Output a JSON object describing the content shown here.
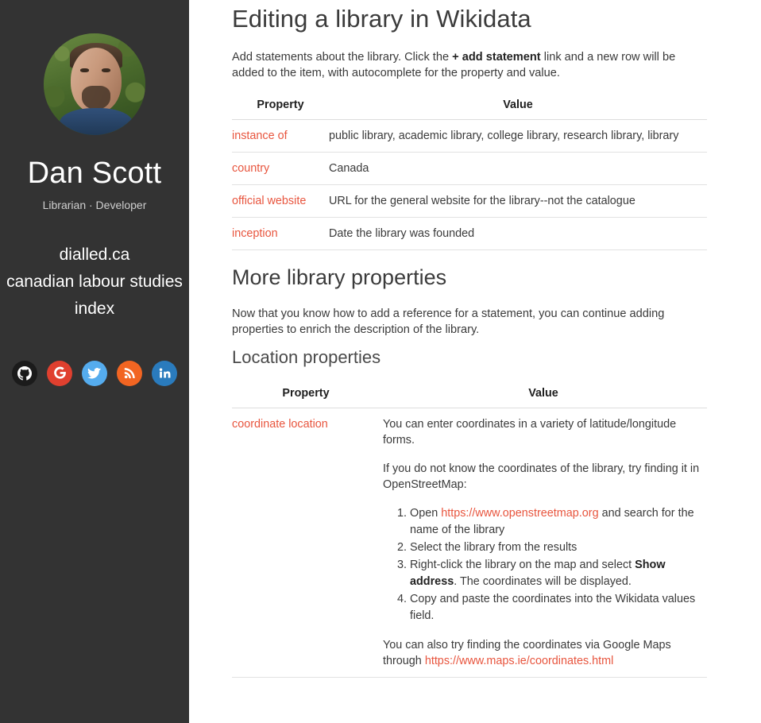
{
  "sidebar": {
    "avatar_alt": "portrait photo of Dan Scott",
    "name": "Dan Scott",
    "tagline": "Librarian · Developer",
    "nav": [
      {
        "label": "dialled.ca"
      },
      {
        "label": "canadian labour studies index"
      }
    ],
    "social": [
      {
        "name": "github-icon",
        "label": "GitHub",
        "color": "#1b1b1b"
      },
      {
        "name": "google-icon",
        "label": "Google",
        "color": "#e0402f"
      },
      {
        "name": "twitter-icon",
        "label": "Twitter",
        "color": "#55acee"
      },
      {
        "name": "rss-icon",
        "label": "RSS",
        "color": "#f26522"
      },
      {
        "name": "linkedin-icon",
        "label": "LinkedIn",
        "color": "#2a7bbd"
      }
    ]
  },
  "main": {
    "page_title": "Editing a library in Wikidata",
    "intro": {
      "part1": "Add statements about the library. Click the ",
      "bold": "+ add statement",
      "part2": " link and a new row will be added to the item, with autocomplete for the property and value."
    },
    "table1": {
      "headers": [
        "Property",
        "Value"
      ],
      "rows": [
        {
          "property": "instance of",
          "value": "public library, academic library, college library, research library, library"
        },
        {
          "property": "country",
          "value": "Canada"
        },
        {
          "property": "official website",
          "value": "URL for the general website for the library--not the catalogue"
        },
        {
          "property": "inception",
          "value": "Date the library was founded"
        }
      ]
    },
    "section2": {
      "title": "More library properties",
      "paragraph": "Now that you know how to add a reference for a statement, you can continue adding properties to enrich the description of the library."
    },
    "section3": {
      "title": "Location properties"
    },
    "table2": {
      "headers": [
        "Property",
        "Value"
      ],
      "row": {
        "property": "coordinate location",
        "para1": "You can enter coordinates in a variety of latitude/longitude forms.",
        "para2": "If you do not know the coordinates of the library, try finding it in OpenStreetMap:",
        "steps": [
          {
            "pre": "Open ",
            "link": "https://www.openstreetmap.org",
            "post": " and search for the name of the library"
          },
          {
            "pre": "Select the library from the results",
            "link": "",
            "post": ""
          },
          {
            "pre": "Right-click the library on the map and select ",
            "bold": "Show address",
            "post": ". The coordinates will be displayed."
          },
          {
            "pre": "Copy and paste the coordinates into the Wikidata values field.",
            "link": "",
            "post": ""
          }
        ],
        "para3_pre": "You can also try finding the coordinates via Google Maps through ",
        "para3_link": "https://www.maps.ie/coordinates.html"
      }
    }
  },
  "colors": {
    "sidebar_bg": "#333333",
    "link": "#e8553e",
    "text": "#3a3a3a",
    "heading": "#3b3b3b",
    "table_border": "#e2e2e2"
  }
}
